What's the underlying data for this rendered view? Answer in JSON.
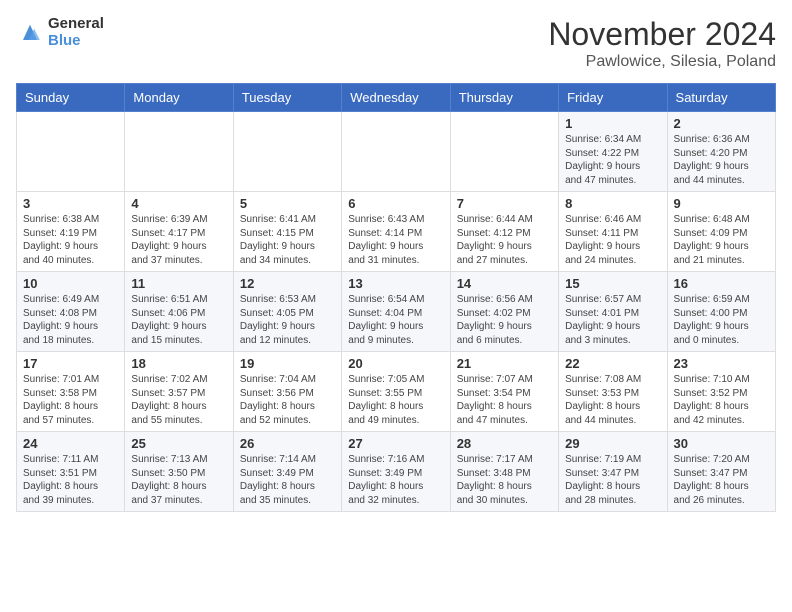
{
  "header": {
    "logo_general": "General",
    "logo_blue": "Blue",
    "month_title": "November 2024",
    "location": "Pawlowice, Silesia, Poland"
  },
  "days_of_week": [
    "Sunday",
    "Monday",
    "Tuesday",
    "Wednesday",
    "Thursday",
    "Friday",
    "Saturday"
  ],
  "weeks": [
    [
      {
        "day": "",
        "info": ""
      },
      {
        "day": "",
        "info": ""
      },
      {
        "day": "",
        "info": ""
      },
      {
        "day": "",
        "info": ""
      },
      {
        "day": "",
        "info": ""
      },
      {
        "day": "1",
        "info": "Sunrise: 6:34 AM\nSunset: 4:22 PM\nDaylight: 9 hours\nand 47 minutes."
      },
      {
        "day": "2",
        "info": "Sunrise: 6:36 AM\nSunset: 4:20 PM\nDaylight: 9 hours\nand 44 minutes."
      }
    ],
    [
      {
        "day": "3",
        "info": "Sunrise: 6:38 AM\nSunset: 4:19 PM\nDaylight: 9 hours\nand 40 minutes."
      },
      {
        "day": "4",
        "info": "Sunrise: 6:39 AM\nSunset: 4:17 PM\nDaylight: 9 hours\nand 37 minutes."
      },
      {
        "day": "5",
        "info": "Sunrise: 6:41 AM\nSunset: 4:15 PM\nDaylight: 9 hours\nand 34 minutes."
      },
      {
        "day": "6",
        "info": "Sunrise: 6:43 AM\nSunset: 4:14 PM\nDaylight: 9 hours\nand 31 minutes."
      },
      {
        "day": "7",
        "info": "Sunrise: 6:44 AM\nSunset: 4:12 PM\nDaylight: 9 hours\nand 27 minutes."
      },
      {
        "day": "8",
        "info": "Sunrise: 6:46 AM\nSunset: 4:11 PM\nDaylight: 9 hours\nand 24 minutes."
      },
      {
        "day": "9",
        "info": "Sunrise: 6:48 AM\nSunset: 4:09 PM\nDaylight: 9 hours\nand 21 minutes."
      }
    ],
    [
      {
        "day": "10",
        "info": "Sunrise: 6:49 AM\nSunset: 4:08 PM\nDaylight: 9 hours\nand 18 minutes."
      },
      {
        "day": "11",
        "info": "Sunrise: 6:51 AM\nSunset: 4:06 PM\nDaylight: 9 hours\nand 15 minutes."
      },
      {
        "day": "12",
        "info": "Sunrise: 6:53 AM\nSunset: 4:05 PM\nDaylight: 9 hours\nand 12 minutes."
      },
      {
        "day": "13",
        "info": "Sunrise: 6:54 AM\nSunset: 4:04 PM\nDaylight: 9 hours\nand 9 minutes."
      },
      {
        "day": "14",
        "info": "Sunrise: 6:56 AM\nSunset: 4:02 PM\nDaylight: 9 hours\nand 6 minutes."
      },
      {
        "day": "15",
        "info": "Sunrise: 6:57 AM\nSunset: 4:01 PM\nDaylight: 9 hours\nand 3 minutes."
      },
      {
        "day": "16",
        "info": "Sunrise: 6:59 AM\nSunset: 4:00 PM\nDaylight: 9 hours\nand 0 minutes."
      }
    ],
    [
      {
        "day": "17",
        "info": "Sunrise: 7:01 AM\nSunset: 3:58 PM\nDaylight: 8 hours\nand 57 minutes."
      },
      {
        "day": "18",
        "info": "Sunrise: 7:02 AM\nSunset: 3:57 PM\nDaylight: 8 hours\nand 55 minutes."
      },
      {
        "day": "19",
        "info": "Sunrise: 7:04 AM\nSunset: 3:56 PM\nDaylight: 8 hours\nand 52 minutes."
      },
      {
        "day": "20",
        "info": "Sunrise: 7:05 AM\nSunset: 3:55 PM\nDaylight: 8 hours\nand 49 minutes."
      },
      {
        "day": "21",
        "info": "Sunrise: 7:07 AM\nSunset: 3:54 PM\nDaylight: 8 hours\nand 47 minutes."
      },
      {
        "day": "22",
        "info": "Sunrise: 7:08 AM\nSunset: 3:53 PM\nDaylight: 8 hours\nand 44 minutes."
      },
      {
        "day": "23",
        "info": "Sunrise: 7:10 AM\nSunset: 3:52 PM\nDaylight: 8 hours\nand 42 minutes."
      }
    ],
    [
      {
        "day": "24",
        "info": "Sunrise: 7:11 AM\nSunset: 3:51 PM\nDaylight: 8 hours\nand 39 minutes."
      },
      {
        "day": "25",
        "info": "Sunrise: 7:13 AM\nSunset: 3:50 PM\nDaylight: 8 hours\nand 37 minutes."
      },
      {
        "day": "26",
        "info": "Sunrise: 7:14 AM\nSunset: 3:49 PM\nDaylight: 8 hours\nand 35 minutes."
      },
      {
        "day": "27",
        "info": "Sunrise: 7:16 AM\nSunset: 3:49 PM\nDaylight: 8 hours\nand 32 minutes."
      },
      {
        "day": "28",
        "info": "Sunrise: 7:17 AM\nSunset: 3:48 PM\nDaylight: 8 hours\nand 30 minutes."
      },
      {
        "day": "29",
        "info": "Sunrise: 7:19 AM\nSunset: 3:47 PM\nDaylight: 8 hours\nand 28 minutes."
      },
      {
        "day": "30",
        "info": "Sunrise: 7:20 AM\nSunset: 3:47 PM\nDaylight: 8 hours\nand 26 minutes."
      }
    ]
  ]
}
